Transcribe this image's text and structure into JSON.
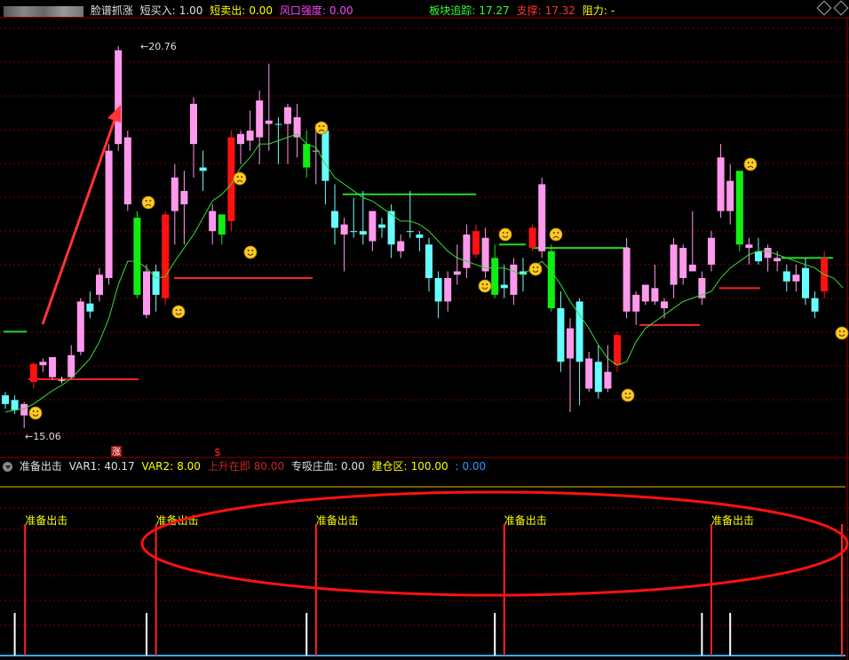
{
  "header": {
    "indicator_name": "脸谱抓涨",
    "items": [
      {
        "label": "短买入:",
        "value": "1.00",
        "color": "#e0e0e0"
      },
      {
        "label": "短卖出:",
        "value": "0.00",
        "color": "#ffff00"
      },
      {
        "label": "风口强度:",
        "value": "0.00",
        "color": "#ff44ff"
      },
      {
        "label": "板块追踪:",
        "value": "17.27",
        "color": "#33ff33"
      },
      {
        "label": "支撑:",
        "value": "17.32",
        "color": "#ff3333"
      },
      {
        "label": "阻力:",
        "value": "-",
        "color": "#ffff00"
      }
    ]
  },
  "subheader": {
    "indicator_name": "准备出击",
    "items": [
      {
        "label": "VAR1:",
        "value": "40.17",
        "color": "#e0e0e0"
      },
      {
        "label": "VAR2:",
        "value": "8.00",
        "color": "#ffff00"
      },
      {
        "label": "上升在即",
        "value": "80.00",
        "color": "#cc2222"
      },
      {
        "label": "专吸庄血:",
        "value": "0.00",
        "color": "#e0e0e0"
      },
      {
        "label": "建仓区:",
        "value": "100.00",
        "color": "#ffff00"
      },
      {
        "label": ":",
        "value": "0.00",
        "color": "#3399ff"
      }
    ]
  },
  "colors": {
    "up_pink": "#ff99ee",
    "down_cyan": "#66ffff",
    "up_red": "#ff1111",
    "down_green": "#11ee11",
    "ma_line": "#33dd33",
    "grid": "#7a0000",
    "annotation": "#ff3333"
  },
  "chart_data": [
    {
      "type": "candlestick",
      "annotations": {
        "high_label": "20.76",
        "low_label": "15.06",
        "marker_zhang": "涨",
        "marker_s": "$"
      },
      "price_range": [
        15.06,
        20.76
      ],
      "candles": [
        {
          "o": 15.55,
          "h": 15.6,
          "l": 15.35,
          "c": 15.42,
          "k": "cyan"
        },
        {
          "o": 15.48,
          "h": 15.55,
          "l": 15.27,
          "c": 15.33,
          "k": "cyan"
        },
        {
          "o": 15.25,
          "h": 15.45,
          "l": 15.06,
          "c": 15.42,
          "k": "pink"
        },
        {
          "o": 15.75,
          "h": 16.05,
          "l": 15.65,
          "c": 16.02,
          "k": "red"
        },
        {
          "o": 16.0,
          "h": 16.1,
          "l": 15.9,
          "c": 16.05,
          "k": "pink"
        },
        {
          "o": 15.82,
          "h": 16.1,
          "l": 15.78,
          "c": 16.12,
          "k": "pink"
        },
        {
          "o": 15.78,
          "h": 15.83,
          "l": 15.73,
          "c": 15.78,
          "k": "white"
        },
        {
          "o": 15.82,
          "h": 16.3,
          "l": 15.8,
          "c": 16.15,
          "k": "pink"
        },
        {
          "o": 16.2,
          "h": 17.0,
          "l": 16.15,
          "c": 16.95,
          "k": "pink"
        },
        {
          "o": 16.8,
          "h": 17.1,
          "l": 16.7,
          "c": 16.92,
          "k": "cyan"
        },
        {
          "o": 17.05,
          "h": 17.45,
          "l": 16.95,
          "c": 17.35,
          "k": "pink"
        },
        {
          "o": 17.3,
          "h": 19.3,
          "l": 17.2,
          "c": 19.2,
          "k": "pink"
        },
        {
          "o": 19.3,
          "h": 20.76,
          "l": 19.2,
          "c": 20.7,
          "k": "pink"
        },
        {
          "o": 19.4,
          "h": 19.5,
          "l": 18.3,
          "c": 18.4,
          "k": "pink"
        },
        {
          "o": 18.2,
          "h": 18.3,
          "l": 17.0,
          "c": 17.05,
          "k": "green"
        },
        {
          "o": 16.75,
          "h": 17.5,
          "l": 16.7,
          "c": 17.4,
          "k": "pink"
        },
        {
          "o": 17.05,
          "h": 17.5,
          "l": 16.8,
          "c": 17.4,
          "k": "cyan"
        },
        {
          "o": 17.0,
          "h": 18.3,
          "l": 16.9,
          "c": 18.25,
          "k": "red"
        },
        {
          "o": 18.3,
          "h": 19.0,
          "l": 17.8,
          "c": 18.8,
          "k": "pink"
        },
        {
          "o": 18.4,
          "h": 18.9,
          "l": 17.8,
          "c": 18.6,
          "k": "pink"
        },
        {
          "o": 19.3,
          "h": 20.0,
          "l": 18.8,
          "c": 19.9,
          "k": "pink"
        },
        {
          "o": 18.9,
          "h": 19.2,
          "l": 18.6,
          "c": 18.95,
          "k": "cyan"
        },
        {
          "o": 18.0,
          "h": 18.4,
          "l": 17.8,
          "c": 18.3,
          "k": "pink"
        },
        {
          "o": 17.95,
          "h": 18.2,
          "l": 17.8,
          "c": 18.25,
          "k": "green"
        },
        {
          "o": 18.15,
          "h": 19.5,
          "l": 18.0,
          "c": 19.4,
          "k": "red"
        },
        {
          "o": 19.3,
          "h": 19.5,
          "l": 19.0,
          "c": 19.45,
          "k": "pink"
        },
        {
          "o": 19.35,
          "h": 19.8,
          "l": 19.2,
          "c": 19.5,
          "k": "pink"
        },
        {
          "o": 19.4,
          "h": 20.1,
          "l": 19.0,
          "c": 19.95,
          "k": "pink"
        },
        {
          "o": 19.6,
          "h": 20.5,
          "l": 19.2,
          "c": 19.65,
          "k": "pink"
        },
        {
          "o": 19.6,
          "h": 19.7,
          "l": 19.0,
          "c": 19.6,
          "k": "cyan"
        },
        {
          "o": 19.6,
          "h": 19.9,
          "l": 19.0,
          "c": 19.85,
          "k": "pink"
        },
        {
          "o": 19.7,
          "h": 19.9,
          "l": 19.1,
          "c": 19.4,
          "k": "pink"
        },
        {
          "o": 19.3,
          "h": 19.5,
          "l": 18.8,
          "c": 18.95,
          "k": "green"
        },
        {
          "o": 19.2,
          "h": 19.6,
          "l": 18.7,
          "c": 19.2,
          "k": "pink"
        },
        {
          "o": 19.5,
          "h": 19.6,
          "l": 18.4,
          "c": 18.75,
          "k": "cyan"
        },
        {
          "o": 18.3,
          "h": 18.7,
          "l": 17.8,
          "c": 18.05,
          "k": "cyan"
        },
        {
          "o": 18.1,
          "h": 18.2,
          "l": 17.4,
          "c": 17.95,
          "k": "pink"
        },
        {
          "o": 18.0,
          "h": 18.5,
          "l": 17.9,
          "c": 18.0,
          "k": "cyan"
        },
        {
          "o": 18.0,
          "h": 18.6,
          "l": 17.8,
          "c": 17.95,
          "k": "cyan"
        },
        {
          "o": 18.3,
          "h": 18.3,
          "l": 17.7,
          "c": 17.85,
          "k": "pink"
        },
        {
          "o": 18.1,
          "h": 18.2,
          "l": 17.9,
          "c": 18.05,
          "k": "cyan"
        },
        {
          "o": 18.3,
          "h": 18.4,
          "l": 17.6,
          "c": 17.8,
          "k": "cyan"
        },
        {
          "o": 17.85,
          "h": 17.95,
          "l": 17.6,
          "c": 17.7,
          "k": "pink"
        },
        {
          "o": 18.0,
          "h": 18.6,
          "l": 17.9,
          "c": 18.0,
          "k": "cyan"
        },
        {
          "o": 17.95,
          "h": 18.0,
          "l": 17.7,
          "c": 17.9,
          "k": "cyan"
        },
        {
          "o": 17.8,
          "h": 17.9,
          "l": 17.1,
          "c": 17.3,
          "k": "cyan"
        },
        {
          "o": 17.3,
          "h": 17.4,
          "l": 16.7,
          "c": 16.95,
          "k": "cyan"
        },
        {
          "o": 16.95,
          "h": 17.4,
          "l": 16.8,
          "c": 17.3,
          "k": "pink"
        },
        {
          "o": 17.4,
          "h": 17.8,
          "l": 17.2,
          "c": 17.35,
          "k": "pink"
        },
        {
          "o": 17.45,
          "h": 18.1,
          "l": 17.3,
          "c": 17.95,
          "k": "pink"
        },
        {
          "o": 17.65,
          "h": 18.1,
          "l": 17.6,
          "c": 18.0,
          "k": "red"
        },
        {
          "o": 17.9,
          "h": 18.05,
          "l": 17.3,
          "c": 17.4,
          "k": "pink"
        },
        {
          "o": 17.6,
          "h": 17.8,
          "l": 17.0,
          "c": 17.05,
          "k": "green"
        },
        {
          "o": 17.2,
          "h": 17.5,
          "l": 17.0,
          "c": 17.15,
          "k": "cyan"
        },
        {
          "o": 17.05,
          "h": 17.6,
          "l": 16.9,
          "c": 17.5,
          "k": "pink"
        },
        {
          "o": 17.4,
          "h": 17.6,
          "l": 17.1,
          "c": 17.35,
          "k": "cyan"
        },
        {
          "o": 17.75,
          "h": 18.1,
          "l": 17.7,
          "c": 18.05,
          "k": "red"
        },
        {
          "o": 17.7,
          "h": 18.8,
          "l": 17.6,
          "c": 18.7,
          "k": "pink"
        },
        {
          "o": 17.7,
          "h": 17.8,
          "l": 16.8,
          "c": 16.85,
          "k": "green"
        },
        {
          "o": 16.85,
          "h": 17.1,
          "l": 15.9,
          "c": 16.05,
          "k": "cyan"
        },
        {
          "o": 16.1,
          "h": 16.7,
          "l": 15.3,
          "c": 16.55,
          "k": "pink"
        },
        {
          "o": 16.95,
          "h": 17.0,
          "l": 15.4,
          "c": 16.05,
          "k": "cyan"
        },
        {
          "o": 16.1,
          "h": 16.2,
          "l": 15.6,
          "c": 15.65,
          "k": "pink"
        },
        {
          "o": 16.05,
          "h": 16.3,
          "l": 15.5,
          "c": 15.6,
          "k": "cyan"
        },
        {
          "o": 15.9,
          "h": 16.3,
          "l": 15.6,
          "c": 15.65,
          "k": "pink"
        },
        {
          "o": 16.0,
          "h": 16.5,
          "l": 15.9,
          "c": 16.45,
          "k": "red"
        },
        {
          "o": 16.8,
          "h": 17.9,
          "l": 16.7,
          "c": 17.75,
          "k": "pink"
        },
        {
          "o": 16.8,
          "h": 17.1,
          "l": 16.6,
          "c": 17.05,
          "k": "pink"
        },
        {
          "o": 16.95,
          "h": 17.1,
          "l": 16.9,
          "c": 17.2,
          "k": "pink"
        },
        {
          "o": 16.95,
          "h": 17.5,
          "l": 16.9,
          "c": 17.15,
          "k": "pink"
        },
        {
          "o": 16.85,
          "h": 17.0,
          "l": 16.7,
          "c": 16.95,
          "k": "pink"
        },
        {
          "o": 17.2,
          "h": 17.9,
          "l": 17.0,
          "c": 17.8,
          "k": "pink"
        },
        {
          "o": 17.3,
          "h": 17.8,
          "l": 17.2,
          "c": 17.75,
          "k": "pink"
        },
        {
          "o": 17.5,
          "h": 18.3,
          "l": 17.4,
          "c": 17.4,
          "k": "pink"
        },
        {
          "o": 17.0,
          "h": 17.4,
          "l": 16.9,
          "c": 17.3,
          "k": "pink"
        },
        {
          "o": 17.5,
          "h": 18.0,
          "l": 17.4,
          "c": 17.9,
          "k": "pink"
        },
        {
          "o": 18.3,
          "h": 19.3,
          "l": 18.2,
          "c": 19.1,
          "k": "pink"
        },
        {
          "o": 18.3,
          "h": 19.0,
          "l": 18.1,
          "c": 18.75,
          "k": "pink"
        },
        {
          "o": 18.9,
          "h": 18.9,
          "l": 17.7,
          "c": 17.8,
          "k": "green"
        },
        {
          "o": 17.8,
          "h": 17.9,
          "l": 17.5,
          "c": 17.75,
          "k": "pink"
        },
        {
          "o": 17.7,
          "h": 17.9,
          "l": 17.5,
          "c": 17.55,
          "k": "cyan"
        },
        {
          "o": 17.75,
          "h": 17.8,
          "l": 17.4,
          "c": 17.6,
          "k": "pink"
        },
        {
          "o": 17.55,
          "h": 17.7,
          "l": 17.4,
          "c": 17.6,
          "k": "pink"
        },
        {
          "o": 17.4,
          "h": 17.5,
          "l": 17.1,
          "c": 17.25,
          "k": "cyan"
        },
        {
          "o": 17.25,
          "h": 17.5,
          "l": 17.1,
          "c": 17.35,
          "k": "pink"
        },
        {
          "o": 17.45,
          "h": 17.6,
          "l": 16.9,
          "c": 17.0,
          "k": "cyan"
        },
        {
          "o": 17.0,
          "h": 17.1,
          "l": 16.7,
          "c": 16.8,
          "k": "cyan"
        },
        {
          "o": 17.1,
          "h": 17.7,
          "l": 17.0,
          "c": 17.6,
          "k": "red"
        }
      ],
      "ma_line": [
        15.3,
        15.33,
        15.35,
        15.42,
        15.52,
        15.62,
        15.7,
        15.8,
        15.95,
        16.1,
        16.35,
        16.7,
        17.2,
        17.55,
        17.55,
        17.45,
        17.3,
        17.32,
        17.55,
        17.75,
        17.95,
        18.2,
        18.45,
        18.55,
        18.7,
        18.95,
        19.1,
        19.3,
        19.3,
        19.35,
        19.4,
        19.45,
        19.3,
        19.25,
        19.0,
        18.8,
        18.7,
        18.6,
        18.5,
        18.45,
        18.35,
        18.25,
        18.15,
        18.15,
        18.1,
        18.0,
        17.85,
        17.7,
        17.6,
        17.55,
        17.5,
        17.45,
        17.45,
        17.45,
        17.4,
        17.35,
        17.45,
        17.55,
        17.4,
        17.2,
        16.95,
        16.75,
        16.55,
        16.3,
        16.1,
        16.0,
        16.05,
        16.35,
        16.55,
        16.65,
        16.75,
        16.85,
        16.95,
        17.0,
        17.05,
        17.1,
        17.3,
        17.45,
        17.55,
        17.65,
        17.7,
        17.7,
        17.65,
        17.6,
        17.55,
        17.5,
        17.45,
        17.35,
        17.3,
        17.15
      ]
    },
    {
      "type": "signal-bars",
      "signal_label": "准备出击",
      "signal_positions": [
        2,
        16,
        33,
        53,
        75
      ],
      "white_spike_positions": [
        1,
        15,
        32,
        52,
        74,
        77
      ]
    }
  ]
}
